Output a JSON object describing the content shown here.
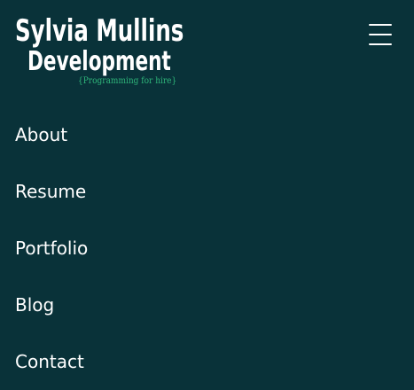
{
  "brand": {
    "name_line1": "Sylvia Mullins",
    "name_line2": "Development",
    "tagline": "{Programming for hire}"
  },
  "header": {
    "menu_icon": "hamburger-menu-icon"
  },
  "nav": {
    "items": [
      {
        "label": "About"
      },
      {
        "label": "Resume"
      },
      {
        "label": "Portfolio"
      },
      {
        "label": "Blog"
      },
      {
        "label": "Contact"
      }
    ]
  },
  "colors": {
    "background": "#093239",
    "text": "#ffffff",
    "tagline": "#2fb67a"
  }
}
